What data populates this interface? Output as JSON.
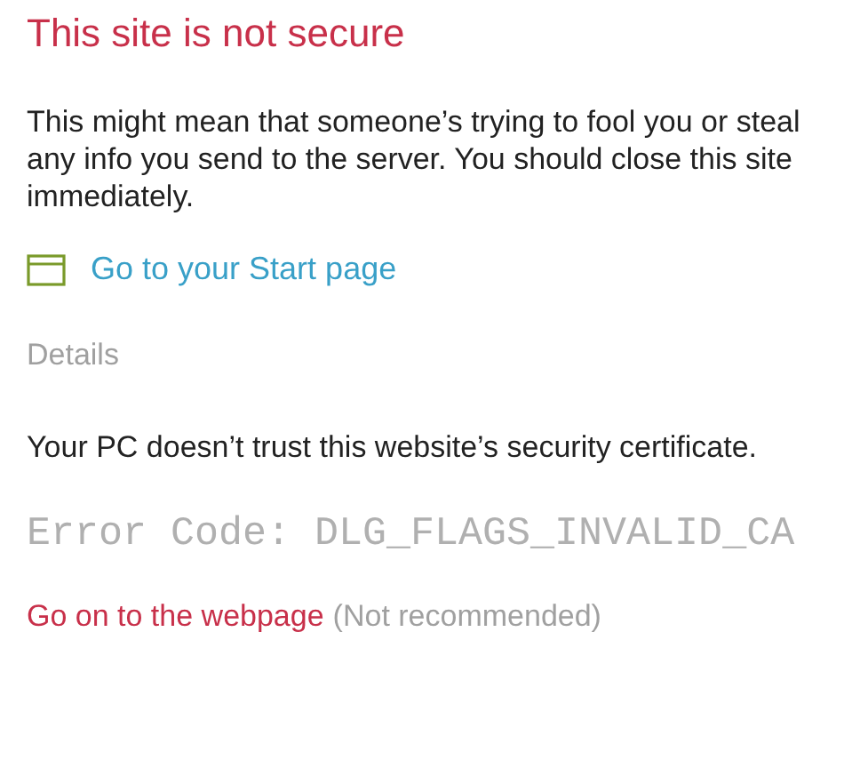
{
  "title": "This site is not secure",
  "message": "This might mean that someone’s trying to fool you or steal any info you send to the server. You should close this site immediately.",
  "start_link": "Go to your Start page",
  "details": "Details",
  "detail_text": "Your PC doesn’t trust this website’s security certificate.",
  "error_code": "Error Code: DLG_FLAGS_INVALID_CA",
  "continue_link": "Go on to the webpage",
  "continue_note": "(Not recommended)"
}
